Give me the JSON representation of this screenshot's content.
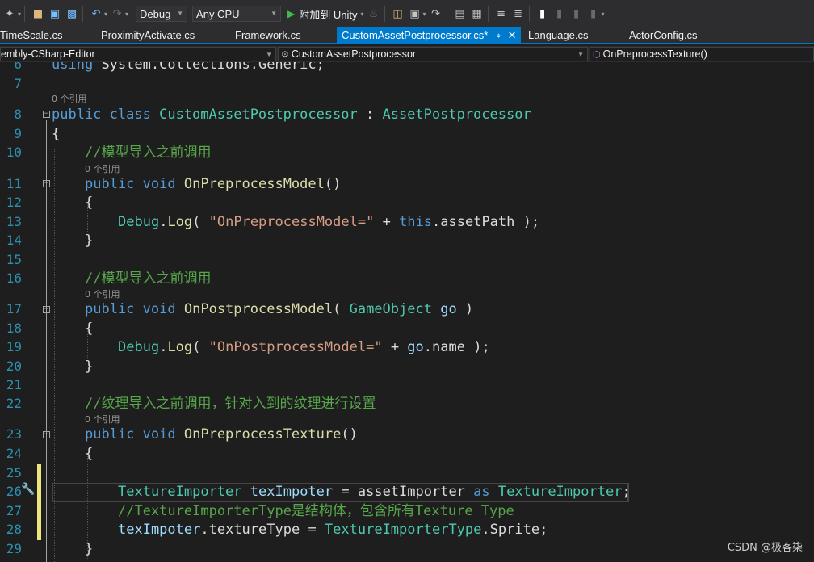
{
  "toolbar": {
    "configuration": "Debug",
    "platform": "Any CPU",
    "run_label": "附加到 Unity",
    "icons": [
      "new-item-icon",
      "open-icon",
      "save-icon",
      "save-all-icon",
      "undo-icon",
      "redo-icon"
    ]
  },
  "tabs": [
    {
      "label": "TimeScale.cs"
    },
    {
      "label": "ProximityActivate.cs"
    },
    {
      "label": "Framework.cs"
    },
    {
      "label": "CustomAssetPostprocessor.cs*",
      "active": true
    },
    {
      "label": "Language.cs"
    },
    {
      "label": "ActorConfig.cs"
    }
  ],
  "navbar": {
    "project": "embly-CSharp-Editor",
    "class": "CustomAssetPostprocessor",
    "member": "OnPreprocessTexture()"
  },
  "editor": {
    "lines": [
      {
        "n": "6",
        "code": "using System.Collections.Generic;"
      },
      {
        "n": "7",
        "code": ""
      },
      {
        "n": "8",
        "code": "public class CustomAssetPostprocessor : AssetPostprocessor"
      },
      {
        "n": "9",
        "code": "{"
      },
      {
        "n": "10",
        "code": "//模型导入之前调用"
      },
      {
        "n": "11",
        "code": "public void OnPreprocessModel()"
      },
      {
        "n": "12",
        "code": "{"
      },
      {
        "n": "13",
        "code": "Debug.Log( \"OnPreprocessModel=\" + this.assetPath );"
      },
      {
        "n": "14",
        "code": "}"
      },
      {
        "n": "15",
        "code": ""
      },
      {
        "n": "16",
        "code": "//模型导入之前调用"
      },
      {
        "n": "17",
        "code": "public void OnPostprocessModel( GameObject go )"
      },
      {
        "n": "18",
        "code": "{"
      },
      {
        "n": "19",
        "code": "Debug.Log( \"OnPostprocessModel=\" + go.name );"
      },
      {
        "n": "20",
        "code": "}"
      },
      {
        "n": "21",
        "code": ""
      },
      {
        "n": "22",
        "code": "//纹理导入之前调用，针对入到的纹理进行设置"
      },
      {
        "n": "23",
        "code": "public void OnPreprocessTexture()"
      },
      {
        "n": "24",
        "code": "{"
      },
      {
        "n": "25",
        "code": ""
      },
      {
        "n": "26",
        "code": "TextureImporter texImpoter = assetImporter as TextureImporter;"
      },
      {
        "n": "27",
        "code": "//TextureImporterType是结构体，包含所有Texture Type"
      },
      {
        "n": "28",
        "code": "texImpoter.textureType = TextureImporterType.Sprite;"
      },
      {
        "n": "29",
        "code": "}"
      }
    ],
    "codelens": "0 个引用"
  },
  "watermark": "CSDN @极客柒",
  "colors": {
    "keyword": "#569cd6",
    "type": "#4ec9b0",
    "method": "#dcdcaa",
    "string": "#d69d85",
    "comment": "#57a64a",
    "variable": "#9cdcfe",
    "accent": "#007acc"
  }
}
